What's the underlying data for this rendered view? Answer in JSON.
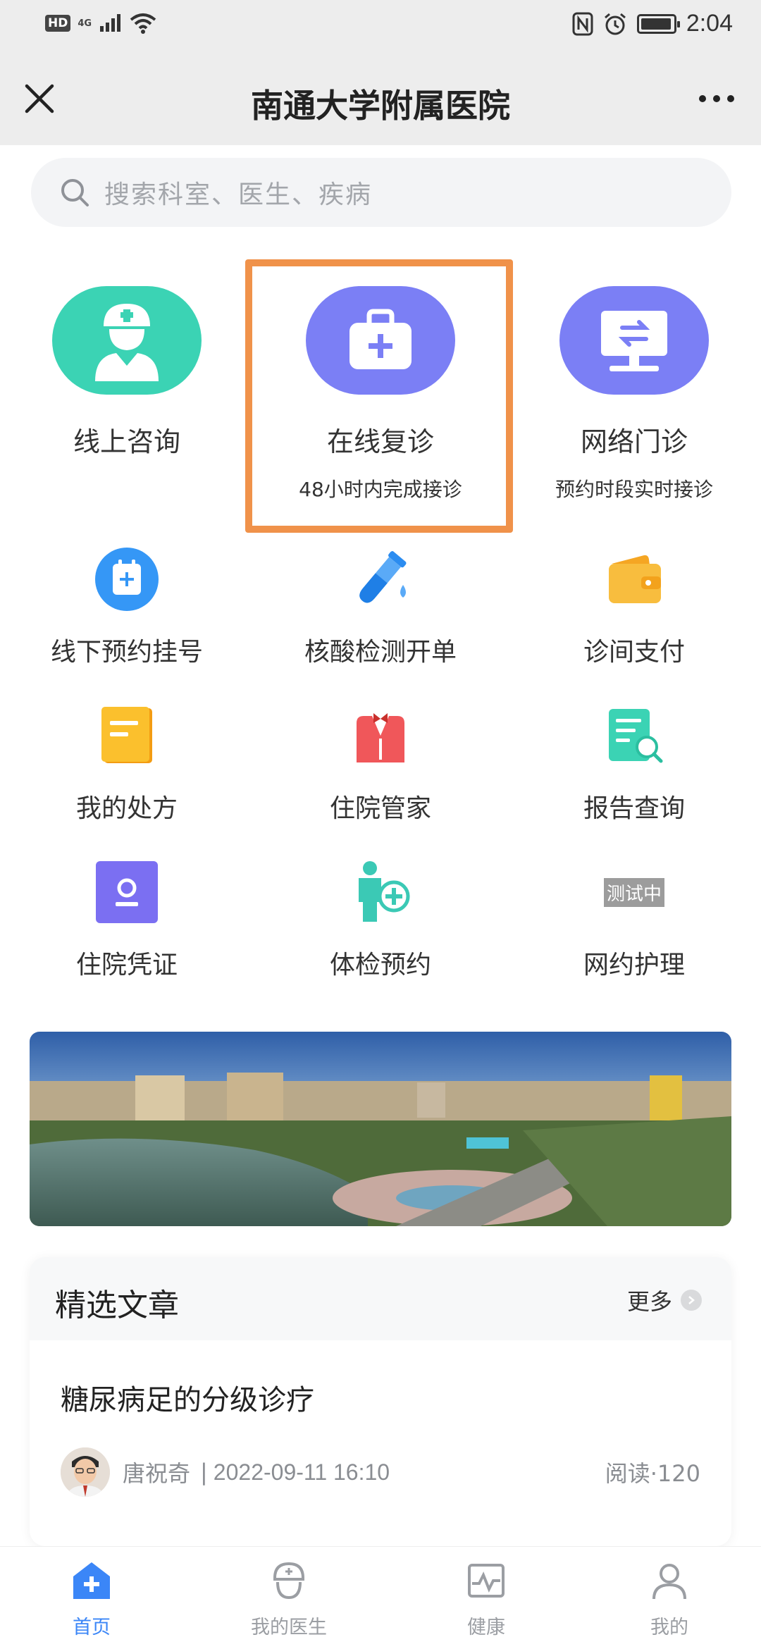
{
  "status_bar": {
    "hd": "HD",
    "network": "4G",
    "time": "2:04"
  },
  "title_bar": {
    "title": "南通大学附属医院"
  },
  "search": {
    "placeholder": "搜索科室、医生、疾病"
  },
  "big_services": [
    {
      "title": "线上咨询",
      "subtitle": "",
      "icon": "nurse-icon",
      "color": "#3bd3b4"
    },
    {
      "title": "在线复诊",
      "subtitle": "48小时内完成接诊",
      "icon": "medical-kit-icon",
      "color": "#7b7ff5"
    },
    {
      "title": "网络门诊",
      "subtitle": "预约时段实时接诊",
      "icon": "monitor-transfer-icon",
      "color": "#7b7ff5"
    }
  ],
  "services": [
    {
      "label": "线下预约挂号",
      "icon": "calendar-icon",
      "color": "#3597f6"
    },
    {
      "label": "核酸检测开单",
      "icon": "test-tube-icon",
      "color": "#3597f6"
    },
    {
      "label": "诊间支付",
      "icon": "wallet-icon",
      "color": "#f8b536"
    },
    {
      "label": "我的处方",
      "icon": "prescription-icon",
      "color": "#f8b536"
    },
    {
      "label": "住院管家",
      "icon": "butler-icon",
      "color": "#f0575a"
    },
    {
      "label": "报告查询",
      "icon": "report-search-icon",
      "color": "#3bd3b4"
    },
    {
      "label": "住院凭证",
      "icon": "certificate-icon",
      "color": "#7b6ff2"
    },
    {
      "label": "体检预约",
      "icon": "checkup-icon",
      "color": "#3bc9b5"
    },
    {
      "label": "网约护理",
      "icon": "testing-badge",
      "color": "#9c9c9c",
      "badge": "测试中"
    }
  ],
  "articles": {
    "section_title": "精选文章",
    "more": "更多",
    "items": [
      {
        "title": "糖尿病足的分级诊疗",
        "author": "唐祝奇",
        "separator": "|",
        "date": "2022-09-11 16:10",
        "reads": "阅读·120"
      }
    ]
  },
  "bottom_nav": [
    {
      "label": "首页",
      "icon": "home-plus-icon",
      "active": true
    },
    {
      "label": "我的医生",
      "icon": "doctor-icon",
      "active": false
    },
    {
      "label": "健康",
      "icon": "health-chart-icon",
      "active": false
    },
    {
      "label": "我的",
      "icon": "profile-icon",
      "active": false
    }
  ],
  "colors": {
    "accent": "#3b86f7",
    "highlight_border": "#f0924a"
  }
}
